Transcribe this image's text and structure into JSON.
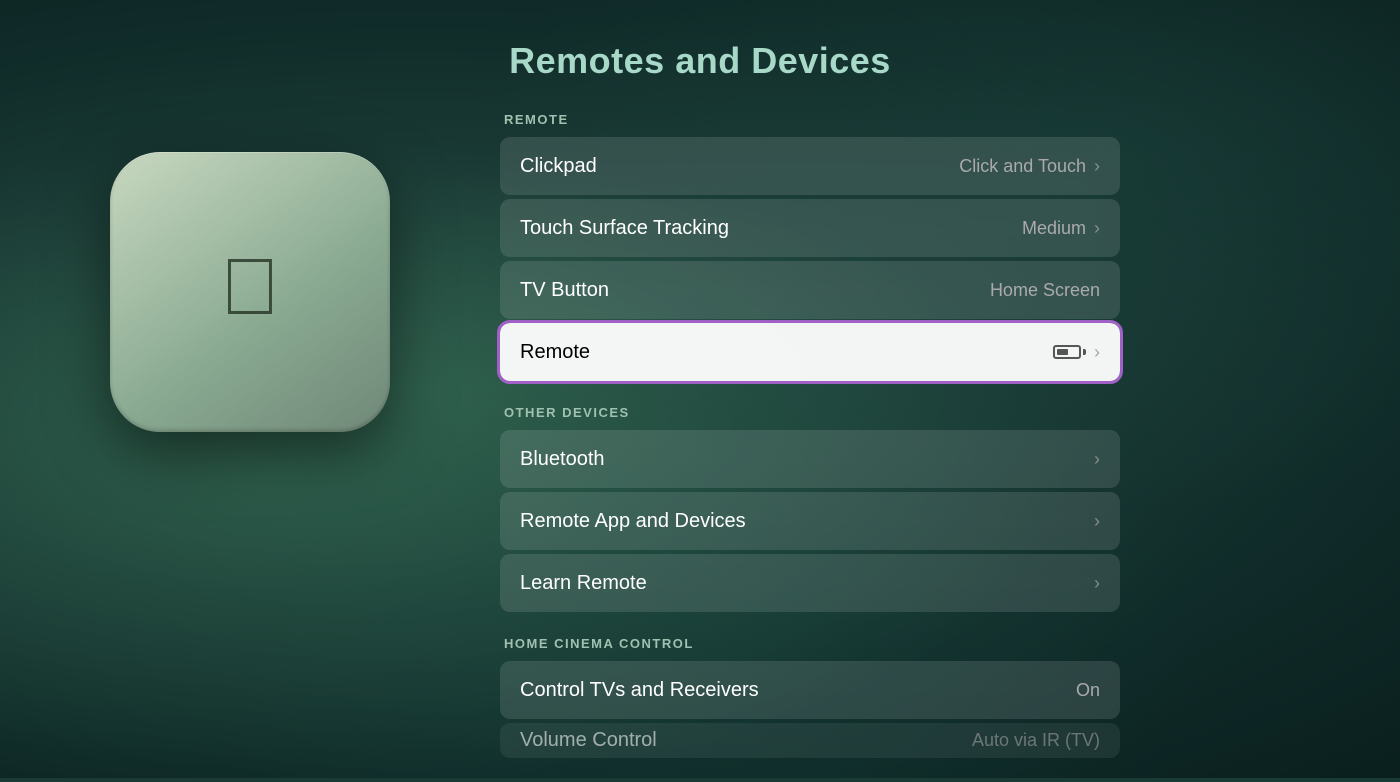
{
  "page": {
    "title": "Remotes and Devices"
  },
  "sections": {
    "remote": {
      "header": "REMOTE",
      "items": [
        {
          "id": "clickpad",
          "label": "Clickpad",
          "value": "Click and Touch",
          "has_chevron": true,
          "focused": false
        },
        {
          "id": "touch-surface-tracking",
          "label": "Touch Surface Tracking",
          "value": "Medium",
          "has_chevron": true,
          "focused": false
        },
        {
          "id": "tv-button",
          "label": "TV Button",
          "value": "Home Screen",
          "has_chevron": false,
          "focused": false
        },
        {
          "id": "remote",
          "label": "Remote",
          "value": "",
          "has_battery": true,
          "has_chevron": true,
          "focused": true
        }
      ]
    },
    "other_devices": {
      "header": "OTHER DEVICES",
      "items": [
        {
          "id": "bluetooth",
          "label": "Bluetooth",
          "value": "",
          "has_chevron": true,
          "focused": false
        },
        {
          "id": "remote-app",
          "label": "Remote App and Devices",
          "value": "",
          "has_chevron": true,
          "focused": false
        },
        {
          "id": "learn-remote",
          "label": "Learn Remote",
          "value": "",
          "has_chevron": true,
          "focused": false
        }
      ]
    },
    "home_cinema": {
      "header": "HOME CINEMA CONTROL",
      "items": [
        {
          "id": "control-tvs",
          "label": "Control TVs and Receivers",
          "value": "On",
          "has_chevron": false,
          "focused": false
        },
        {
          "id": "volume-control",
          "label": "Volume Control",
          "value": "Auto via IR (TV)",
          "has_chevron": false,
          "focused": false,
          "partial": true
        }
      ]
    }
  },
  "icons": {
    "chevron": "›",
    "apple_logo": ""
  }
}
